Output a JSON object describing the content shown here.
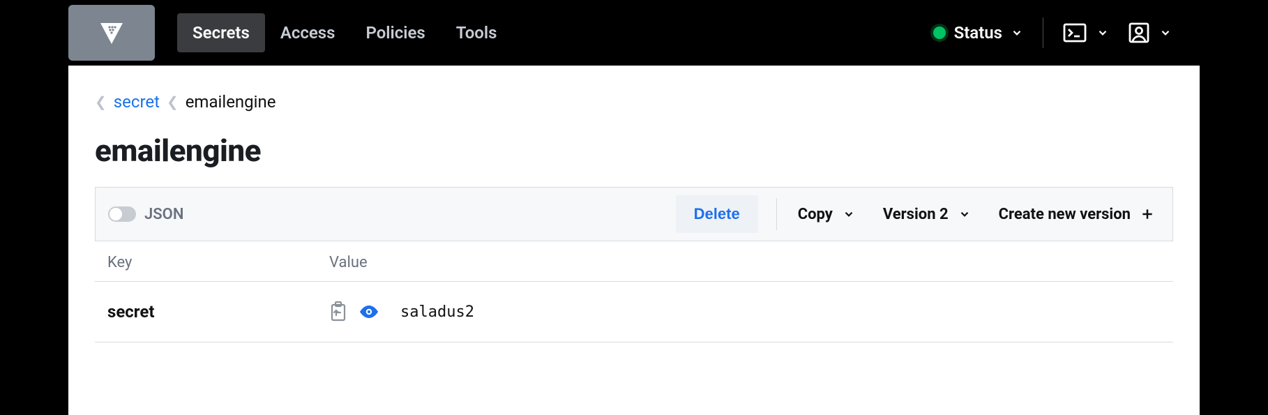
{
  "nav": {
    "items": [
      {
        "label": "Secrets",
        "active": true
      },
      {
        "label": "Access",
        "active": false
      },
      {
        "label": "Policies",
        "active": false
      },
      {
        "label": "Tools",
        "active": false
      }
    ]
  },
  "status": {
    "label": "Status",
    "color": "#00c363"
  },
  "breadcrumb": {
    "items": [
      {
        "label": "secret",
        "link": true
      },
      {
        "label": "emailengine",
        "link": false
      }
    ]
  },
  "page": {
    "title": "emailengine"
  },
  "toolbar": {
    "json_label": "JSON",
    "json_on": false,
    "delete_label": "Delete",
    "copy_label": "Copy",
    "version_label": "Version 2",
    "create_label": "Create new version"
  },
  "table": {
    "head": {
      "key": "Key",
      "value": "Value"
    },
    "rows": [
      {
        "key": "secret",
        "value": "saladus2"
      }
    ]
  },
  "icons": {
    "logo": "vault-logo",
    "chevron_down": "chevron-down-icon",
    "terminal": "terminal-icon",
    "user": "user-icon",
    "plus": "plus-icon",
    "clipboard": "clipboard-icon",
    "eye": "eye-icon"
  },
  "colors": {
    "accent": "#1f6feb",
    "bg_header": "#000000"
  }
}
